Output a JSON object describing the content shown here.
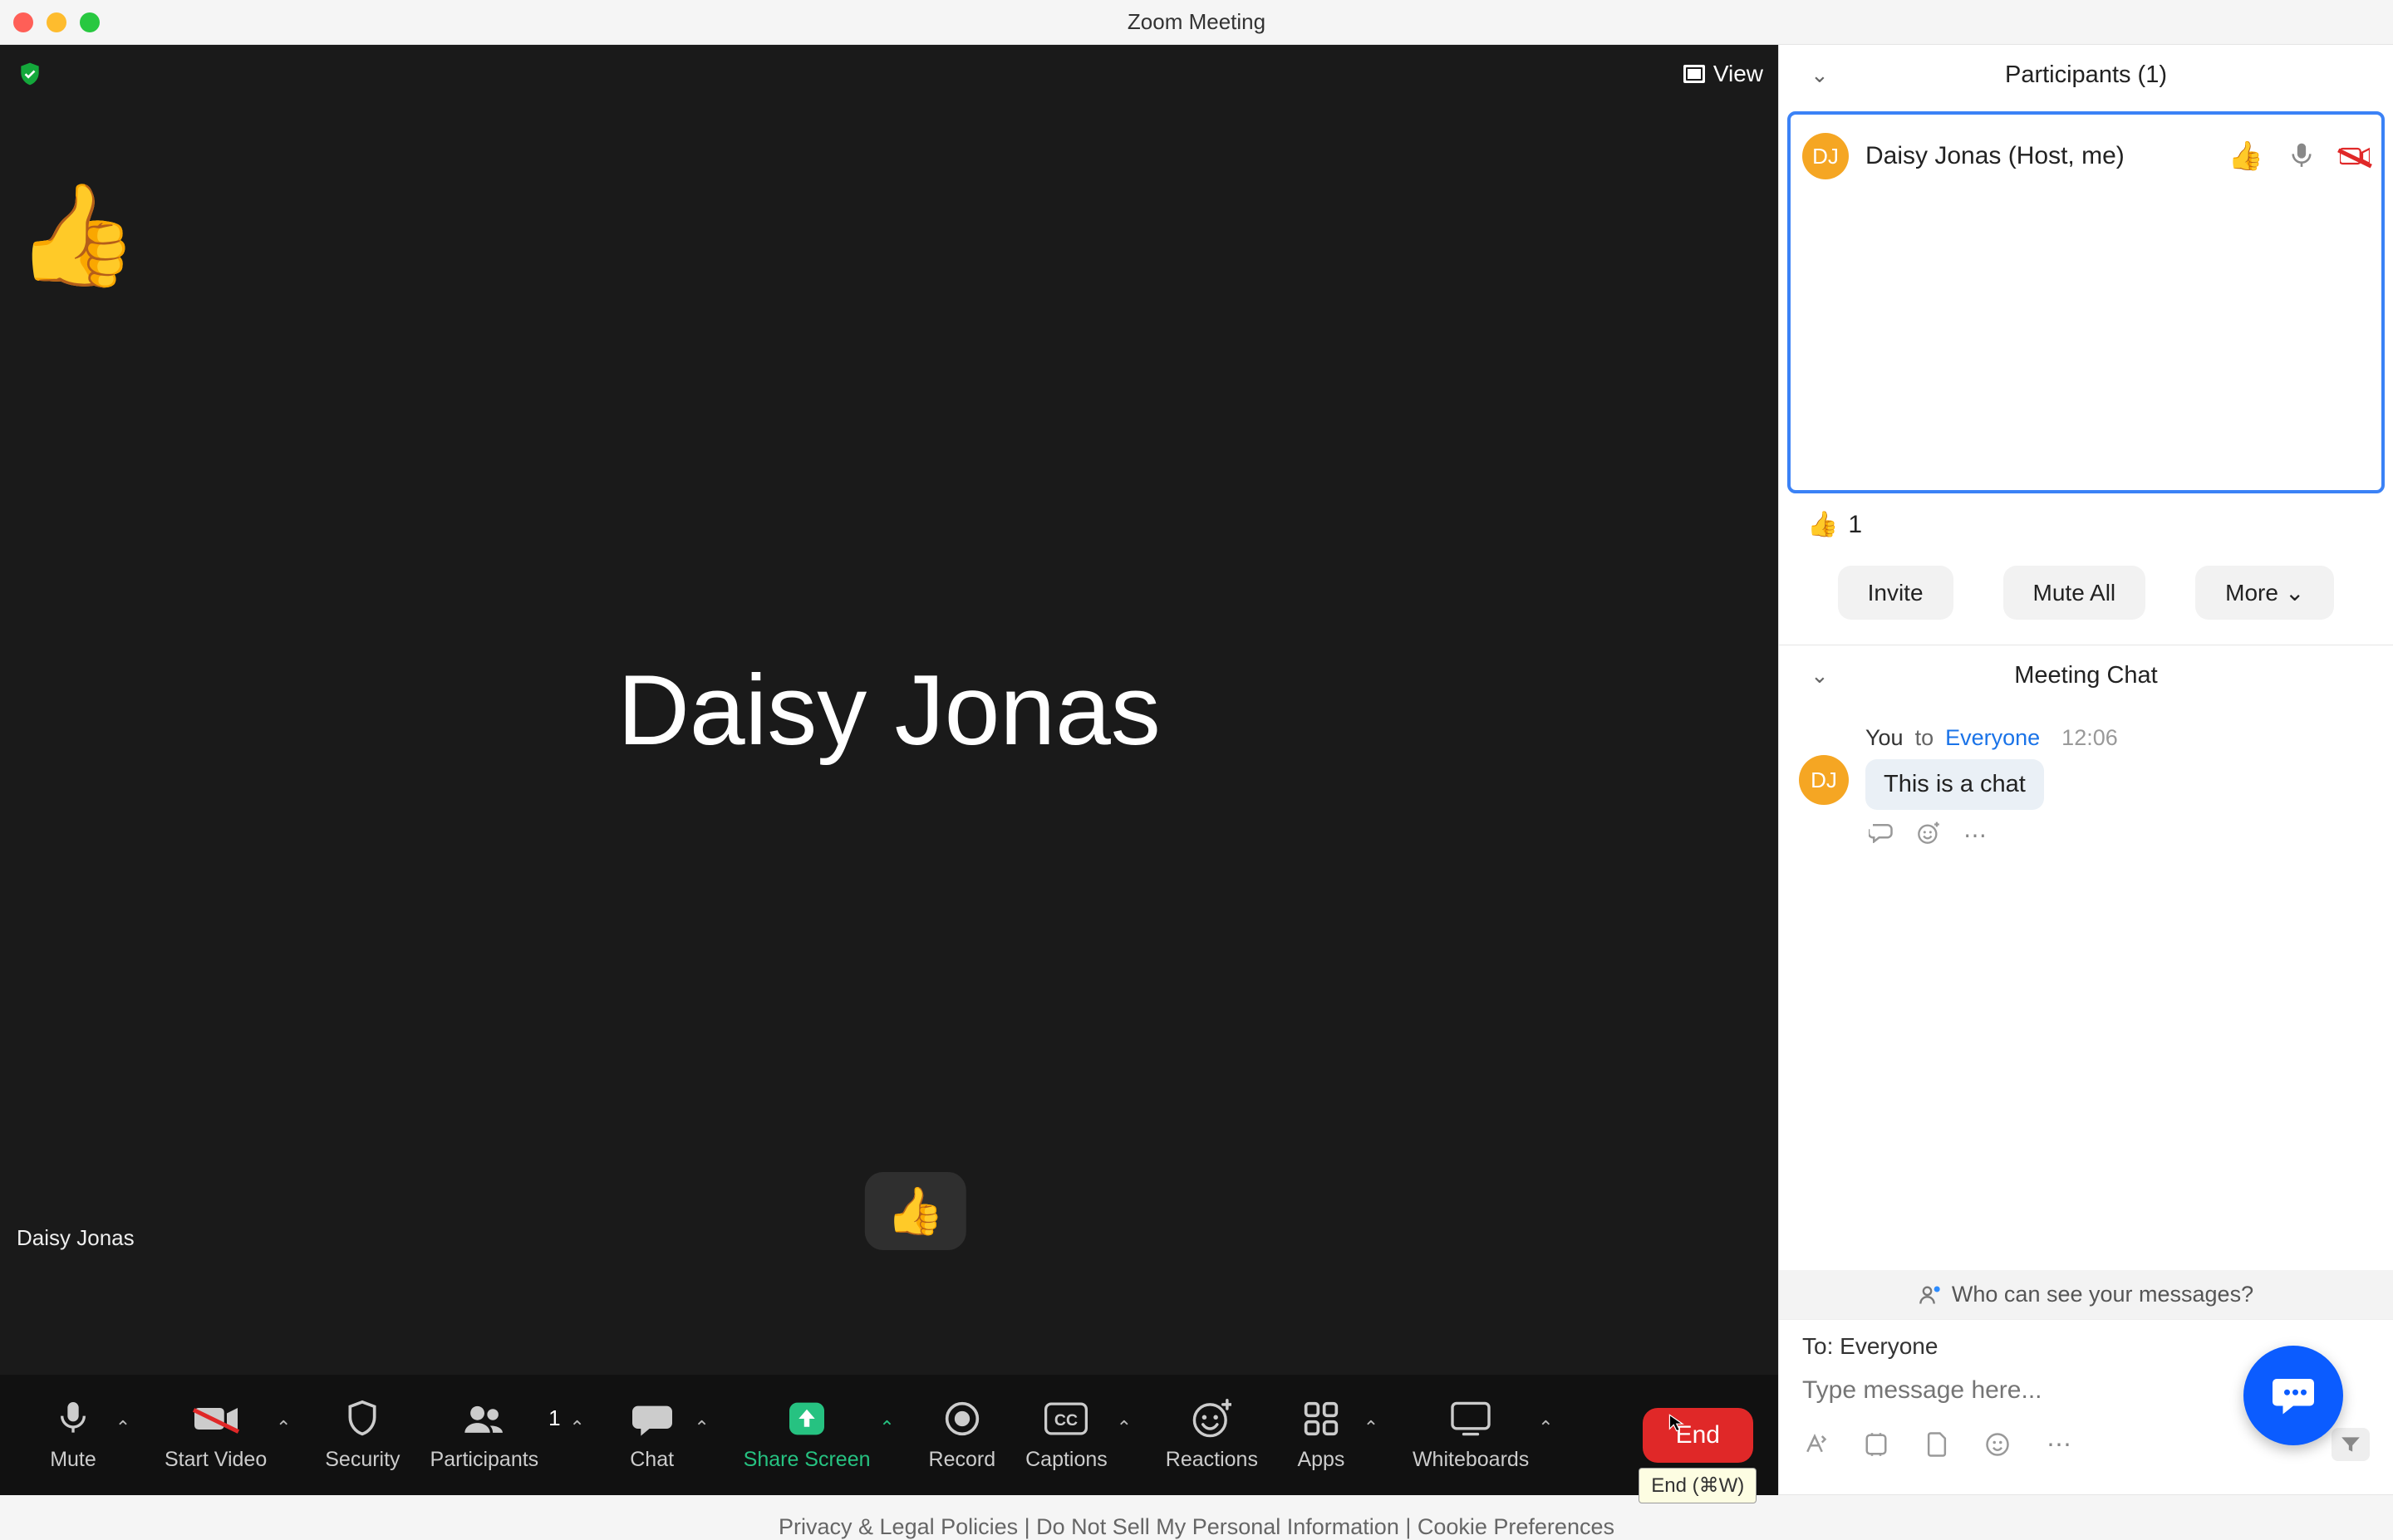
{
  "window": {
    "title": "Zoom Meeting"
  },
  "video": {
    "center_name": "Daisy Jonas",
    "name_tag": "Daisy Jonas",
    "reaction_emoji": "👍",
    "floating_reaction": "👍",
    "view_button_label": "View"
  },
  "toolbar": {
    "mute": "Mute",
    "start_video": "Start Video",
    "security": "Security",
    "participants": "Participants",
    "participants_count": "1",
    "chat": "Chat",
    "share_screen": "Share Screen",
    "record": "Record",
    "captions": "Captions",
    "reactions": "Reactions",
    "apps": "Apps",
    "whiteboards": "Whiteboards",
    "end": "End",
    "end_tooltip": "End (⌘W)"
  },
  "participants_panel": {
    "title": "Participants (1)",
    "items": [
      {
        "avatar_initials": "DJ",
        "name": "Daisy Jonas (Host, me)",
        "reaction": "👍"
      }
    ],
    "reaction_tally_emoji": "👍",
    "reaction_tally_count": "1",
    "invite_label": "Invite",
    "mute_all_label": "Mute All",
    "more_label": "More"
  },
  "chat_panel": {
    "title": "Meeting Chat",
    "message": {
      "avatar_initials": "DJ",
      "from": "You",
      "to_prefix": "to",
      "to_target": "Everyone",
      "timestamp": "12:06",
      "body": "This is a chat"
    },
    "who_can_see": "Who can see your messages?",
    "to_label": "To:",
    "to_value": "Everyone",
    "input_placeholder": "Type message here..."
  },
  "footer_leak": "Privacy & Legal Policies | Do Not Sell My Personal Information | Cookie Preferences"
}
